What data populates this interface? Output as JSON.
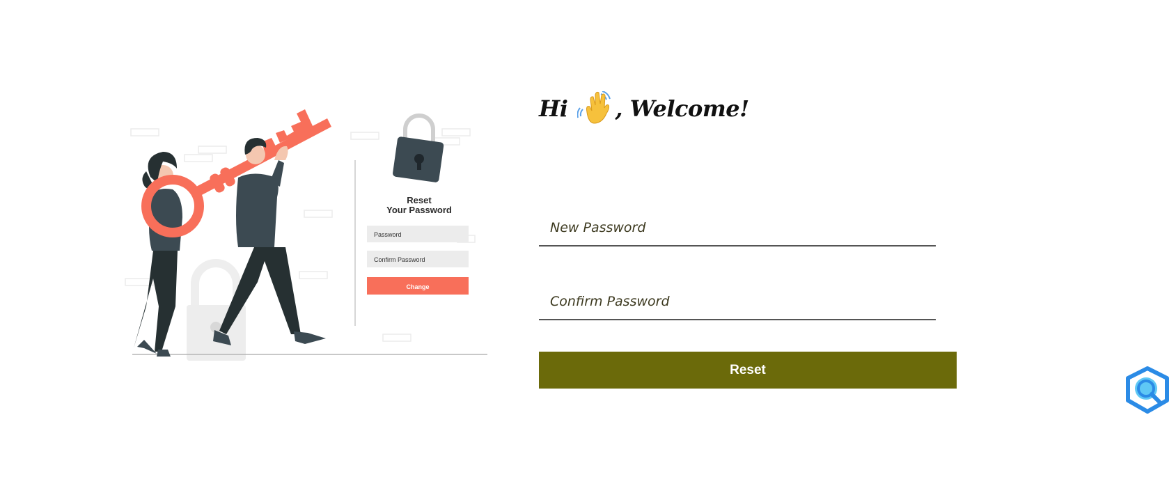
{
  "greeting": {
    "hi": "Hi",
    "welcome": ", Welcome!",
    "emoji_icon": "waving-hand-icon"
  },
  "form": {
    "new_password_placeholder": "New Password",
    "confirm_password_placeholder": "Confirm Password",
    "reset_label": "Reset"
  },
  "illustration": {
    "title_line1": "Reset",
    "title_line2": "Your Password",
    "password_label": "Password",
    "confirm_label": "Confirm Password",
    "change_label": "Change"
  },
  "colors": {
    "accent": "#6b6a0a",
    "illustration_coral": "#f86f5a",
    "illustration_dark": "#3c4a52"
  },
  "floating_icon": "search-assistant-icon"
}
